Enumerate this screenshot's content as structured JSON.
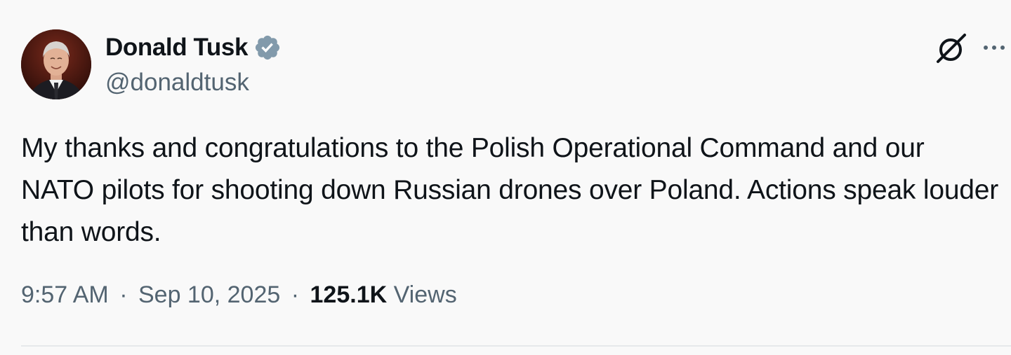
{
  "author": {
    "display_name": "Donald Tusk",
    "handle": "@donaldtusk",
    "verified": true,
    "avatar_icon": "profile-photo"
  },
  "icons": {
    "verified": "verified-badge-icon",
    "grok": "grok-slash-circle-icon",
    "more": "more-horizontal-icon"
  },
  "tweet": {
    "text": "My thanks and congratulations to the Polish Operational Command and our NATO pilots for shooting down Russian drones over Poland. Actions speak louder than words.",
    "time": "9:57 AM",
    "date": "Sep 10, 2025",
    "separator": "·",
    "views_count": "125.1K",
    "views_label": "Views"
  },
  "colors": {
    "background": "#f9f9f9",
    "text_primary": "#0f1419",
    "text_secondary": "#536471",
    "verified_badge": "#829aab"
  }
}
